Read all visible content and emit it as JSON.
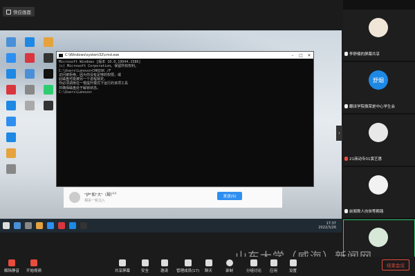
{
  "view_button": {
    "label": "快应画面"
  },
  "desktop_icons": [
    "",
    "",
    "",
    "",
    "",
    "",
    "",
    "",
    "",
    "",
    "",
    "",
    "",
    "",
    "",
    "",
    "",
    "",
    ""
  ],
  "cmd": {
    "title": "C:\\Windows\\system32\\cmd.exe",
    "lines": [
      "Microsoft Windows [版本 10.0.19044.1586]",
      "(c) Microsoft Corporation。保留所有权利。",
      "",
      "C:\\Users\\Lenovo>CHKDSK /F",
      "访问被拒绝，因为你没有足够的权限，或",
      "此磁盘可能被另一个进程锁定。",
      "你必须调用在一根提升模式下运行的该项工具",
      "并确保磁盘处于解锁状态。",
      "",
      "C:\\Users\\Lenovo>"
    ]
  },
  "chat": {
    "name": "\"护\"和\"大\"（出）",
    "time": "15:44",
    "message": "相关一些注入",
    "send_label": "发送(S)"
  },
  "taskbar": {
    "time": "17:37",
    "date": "2022/3/26"
  },
  "participants": [
    {
      "name": "李舒楠的屏幕共享",
      "avatar_text": "",
      "muted": false,
      "active": false
    },
    {
      "name": "翻译学院振荣是中心学生会",
      "avatar_text": "舒烟",
      "muted": false,
      "active": false
    },
    {
      "name": "21商动专01黄艺惠",
      "avatar_text": "",
      "muted": true,
      "active": false
    },
    {
      "name": "前阁欺人向侠等殿路",
      "avatar_text": "",
      "muted": false,
      "active": false
    },
    {
      "name": "候凌有数宽实",
      "avatar_text": "",
      "muted": false,
      "active": true
    }
  ],
  "watermark": "山东大学（威海）新闻网",
  "toolbar": {
    "mute_label": "解除静音",
    "video_label": "开始视频",
    "share_label": "共享屏幕",
    "security_label": "安全",
    "invite_label": "邀请",
    "manage_label": "管理成员(17)",
    "chat_label": "聊天",
    "record_label": "录制",
    "group_label": "分组讨论",
    "apps_label": "应用",
    "settings_label": "设置",
    "end_label": "结束会议"
  },
  "colors": {
    "accent": "#2e8ff0",
    "danger": "#e74c3c",
    "active_border": "#2ecc71"
  }
}
